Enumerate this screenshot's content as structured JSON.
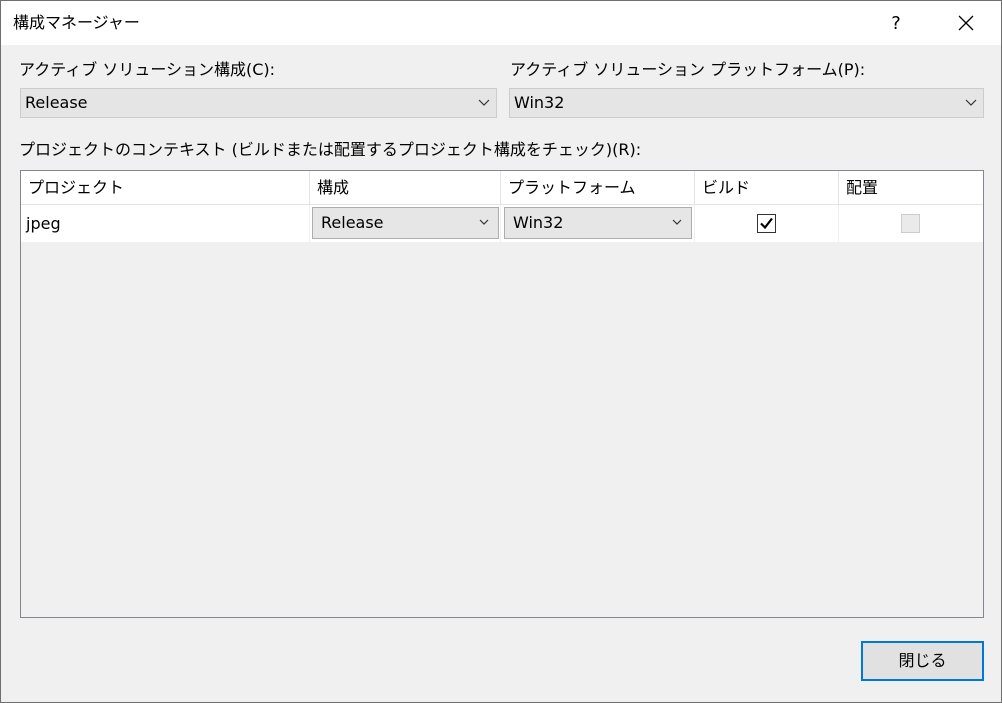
{
  "window": {
    "title": "構成マネージャー",
    "help_label": "?",
    "close_icon": "close-icon"
  },
  "active_config": {
    "label": "アクティブ ソリューション構成(C):",
    "value": "Release"
  },
  "active_platform": {
    "label": "アクティブ ソリューション プラットフォーム(P):",
    "value": "Win32"
  },
  "project_context": {
    "label": "プロジェクトのコンテキスト (ビルドまたは配置するプロジェクト構成をチェック)(R):",
    "columns": {
      "project": "プロジェクト",
      "config": "構成",
      "platform": "プラットフォーム",
      "build": "ビルド",
      "deploy": "配置"
    },
    "rows": [
      {
        "project": "jpeg",
        "config": "Release",
        "platform": "Win32",
        "build_checked": true,
        "deploy_checked": false,
        "deploy_enabled": false
      }
    ]
  },
  "footer": {
    "close_label": "閉じる"
  },
  "colors": {
    "accent": "#0078d7",
    "background": "#f0f0f0",
    "titlebar": "#ffffff"
  }
}
